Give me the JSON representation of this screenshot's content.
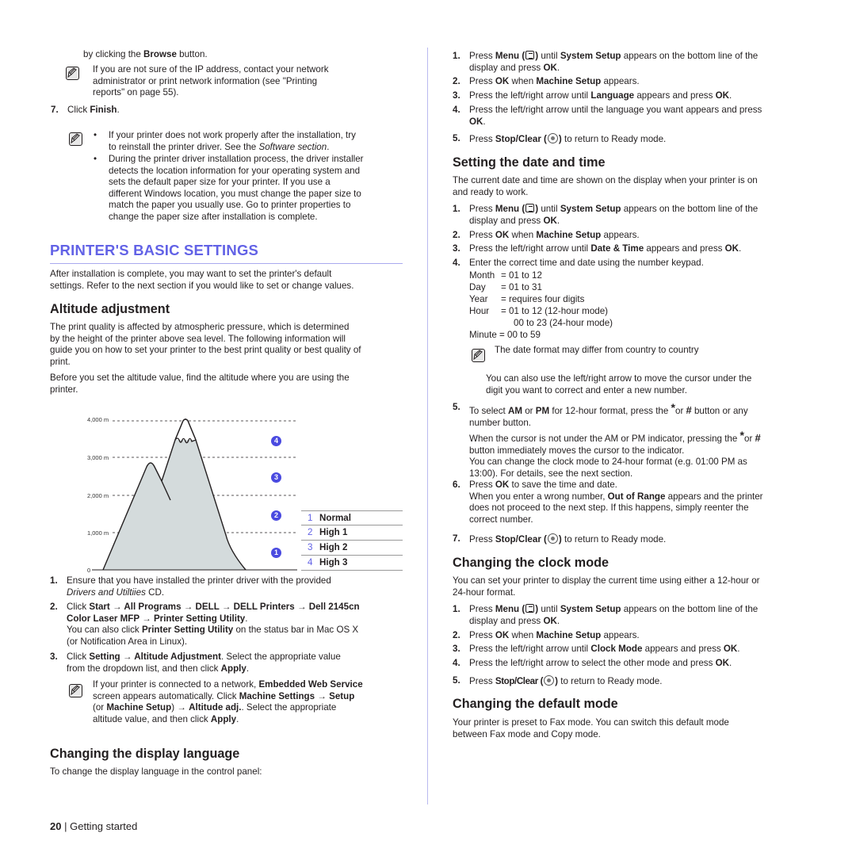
{
  "left": {
    "intro_line": [
      "by clicking the ",
      "Browse",
      " button."
    ],
    "note1": [
      "If you are not sure of the IP address, contact your network",
      "administrator or print network information (see \"Printing",
      "reports\" on page 55)."
    ],
    "step7": {
      "num": "7.",
      "pre": "Click ",
      "bold": "Finish",
      "post": "."
    },
    "note2_bullets": [
      [
        "If your printer does not work properly after the installation, try",
        "to reinstall the printer driver. See the ",
        "Software section",
        "."
      ],
      [
        "During the printer driver installation process, the driver installer",
        "detects the location information for your operating system and",
        "sets the default paper size for your printer. If you use a",
        "different Windows location, you must change the paper size to",
        "match the paper you usually use. Go to printer properties to",
        "change the paper size after installation is complete."
      ]
    ],
    "section_title": "PRINTER'S BASIC SETTINGS",
    "section_intro": [
      "After installation is complete, you may want to set the printer's default",
      "settings. Refer to the next section if you would like to set or change values."
    ],
    "altitude": {
      "title": "Altitude adjustment",
      "para1": [
        "The print quality is affected by atmospheric pressure, which is determined",
        "by the height of the printer above sea level. The following information will",
        "guide you on how to set your printer to the best print quality or best quality of",
        "print."
      ],
      "para2": [
        "Before you set the altitude value, find the altitude where you are using the",
        "printer."
      ],
      "figure": {
        "ticks": [
          "4,000 m",
          "3,000 m",
          "2,000 m",
          "1,000 m",
          "0"
        ],
        "badges": [
          "4",
          "3",
          "2",
          "1"
        ],
        "legend": [
          {
            "num": "1",
            "label": "Normal"
          },
          {
            "num": "2",
            "label": "High 1"
          },
          {
            "num": "3",
            "label": "High 2"
          },
          {
            "num": "4",
            "label": "High 3"
          }
        ]
      },
      "steps": {
        "s1": {
          "num": "1.",
          "l1": "Ensure that you have installed the printer driver with the provided",
          "l2_i": "Drivers and Utiltiies",
          "l2_post": " CD."
        },
        "s2": {
          "num": "2.",
          "pre": "Click ",
          "path1": "Start → All Programs → DELL → DELL Printers → Dell 2145cn",
          "path2": "Color Laser MFP → Printer Setting Utility",
          "post": ".",
          "l3_pre": "You can also click ",
          "l3_b": "Printer Setting Utility",
          "l3_post": " on the status bar in Mac OS X",
          "l4": "(or Notification Area in Linux)."
        },
        "s3": {
          "num": "3.",
          "pre": "Click ",
          "b": "Setting → Altitude Adjustment",
          "post": ". Select the appropriate value",
          "l2_pre": "from the dropdown list, and then click ",
          "l2_b": "Apply",
          "l2_post": "."
        }
      },
      "note3": {
        "l1_pre": "If your printer is connected to a network, ",
        "l1_b": "Embedded Web Service",
        "l2_pre": "screen appears automatically. Click ",
        "l2_b": "Machine Settings → Setup",
        "l3_a": "(or ",
        "l3_b1": "Machine Setup",
        "l3_c": ") → ",
        "l3_b2": "Altitude adj.",
        "l3_d": ". Select the appropriate",
        "l4_pre": "altitude value, and then click ",
        "l4_b": "Apply",
        "l4_post": "."
      }
    },
    "display_language": {
      "title": "Changing the display language",
      "intro": "To change the display language in the control panel:"
    }
  },
  "right": {
    "lang_steps": [
      {
        "num": "1.",
        "a": "Press ",
        "b1": "Menu (",
        "b1c": ")",
        "c": " until ",
        "b2": "System Setup",
        "d": " appears on the bottom line of the",
        "l2a": "display and press ",
        "l2b": "OK",
        "l2c": "."
      },
      {
        "num": "2.",
        "a": "Press ",
        "b1": "OK",
        "c": " when ",
        "b2": "Machine Setup",
        "d": " appears."
      },
      {
        "num": "3.",
        "a": "Press the left/right arrow until ",
        "b1": "Language",
        "c": " appears and press ",
        "b2": "OK",
        "d": "."
      },
      {
        "num": "4.",
        "a": "Press the left/right arrow until the language you want appears and press",
        "l2b": "OK",
        "l2c": "."
      },
      {
        "num": "5.",
        "a": "Press ",
        "b1": "Stop/Clear (",
        "b1c": ")",
        "c": " to return to Ready mode."
      }
    ],
    "datetime": {
      "title": "Setting the date and time",
      "intro": [
        "The current date and time are shown on the display when your printer is on",
        "and ready to work."
      ],
      "step3": {
        "a": "Press the left/right arrow until ",
        "b1": "Date & Time",
        "c": " appears and press ",
        "b2": "OK",
        "d": "."
      },
      "step4": "Enter the correct time and date using the number keypad.",
      "fields": [
        {
          "name": "Month",
          "eq": "= 01 to 12"
        },
        {
          "name": "Day",
          "eq": "= 01 to 31"
        },
        {
          "name": "Year",
          "eq": "= requires four digits"
        },
        {
          "name": "Hour",
          "eq": "= 01 to 12 (12-hour mode)"
        },
        {
          "name": "",
          "eq": "00 to 23 (24-hour mode)"
        },
        {
          "name": "Minute",
          "eq": "= 00 to 59"
        }
      ],
      "note": "The date format may differ from country to country",
      "also": [
        "You can also use the left/right arrow to move the cursor under the",
        "digit you want to correct and enter a new number."
      ],
      "step5": {
        "a": "To select ",
        "b1": "AM",
        "c": " or ",
        "b2": "PM",
        "d": " for 12-hour format, press the ",
        "star": "*",
        "e": "or ",
        "hash": "#",
        "f": " button or any",
        "l2": "number button."
      },
      "step5_more": {
        "a": "When the cursor is not under the AM or PM indicator, pressing the ",
        "star": "*",
        "b": "or ",
        "hash": "#",
        "l2": "button immediately moves the cursor to the indicator.",
        "l3": "You can change the clock mode to 24-hour format (e.g. 01:00 PM as",
        "l4": "13:00). For details, see the next section."
      },
      "step6": {
        "a": "Press ",
        "b": "OK",
        "c": " to save the time and date.",
        "l2a": "When you enter a wrong number, ",
        "l2b": "Out of Range",
        "l2c": " appears and the printer",
        "l3": "does not proceed to the next step. If this happens, simply reenter the",
        "l4": "correct number."
      },
      "step7": {
        "a": "Press ",
        "b": "Stop/Clear (",
        "bc": ")",
        "c": " to return to Ready mode."
      }
    },
    "clock": {
      "title": "Changing the clock mode",
      "intro": [
        "You can set your printer to display the current time using either a 12-hour or",
        "24-hour format."
      ],
      "step3": {
        "a": "Press the left/right arrow until ",
        "b1": "Clock Mode",
        "c": " appears and press ",
        "b2": "OK",
        "d": "."
      },
      "step4": {
        "a": "Press the left/right arrow  to select the other mode and press ",
        "b": "OK",
        "c": "."
      }
    },
    "default_mode": {
      "title": "Changing the default mode",
      "intro": [
        "Your printer is preset to Fax mode. You can switch this default mode",
        "between Fax mode and Copy mode."
      ]
    }
  },
  "footer": {
    "page": "20",
    "sep": "|",
    "section": "Getting started"
  },
  "colors": {
    "accent": "#6262e6",
    "badge": "#4a4ae0",
    "mountain_fill": "#d4dbdc",
    "text": "#231f20"
  }
}
